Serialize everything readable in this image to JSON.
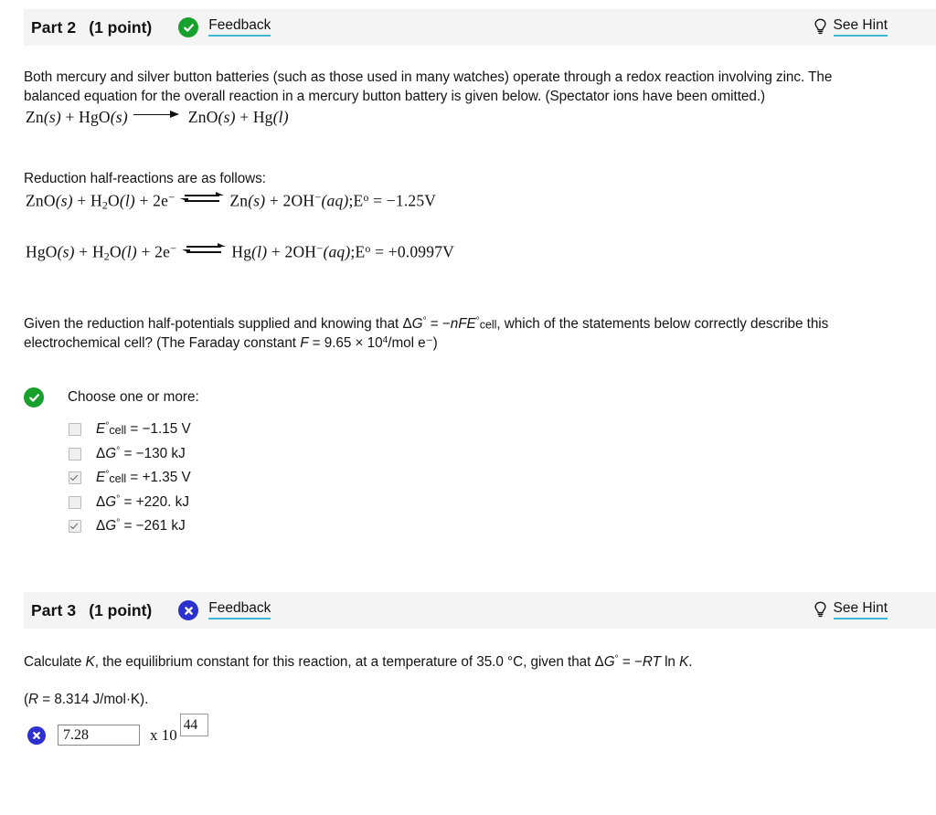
{
  "parts": [
    {
      "title": "Part 2",
      "points": "(1 point)",
      "status": "correct",
      "status_icon": "check-circle-icon",
      "status_color": "#17a02c",
      "feedback_label": "Feedback",
      "hint_label": "See Hint",
      "hint_icon": "lightbulb-icon"
    },
    {
      "title": "Part 3",
      "points": "(1 point)",
      "status": "incorrect",
      "status_icon": "x-circle-icon",
      "status_color": "#2b30cf",
      "feedback_label": "Feedback",
      "hint_label": "See Hint",
      "hint_icon": "lightbulb-icon"
    }
  ],
  "part2": {
    "intro_line1": "Both mercury and silver button batteries (such as those used in many watches) operate through a redox reaction involving zinc. The",
    "intro_line2": "balanced equation for the overall reaction in a mercury button battery is given below. (Spectator ions have been omitted.)",
    "overall_equation": {
      "left": "Zn(s) + HgO(s)",
      "right": "ZnO(s) + Hg(l)",
      "arrow": "long-right-arrow"
    },
    "halfrxn_heading": "Reduction half-reactions are as follows:",
    "half_reaction_1": {
      "reactants": "ZnO(s) + H2O(l) + 2e⁻",
      "products": "Zn(s) + 2OH⁻(aq)",
      "potential_label": "Eº",
      "potential_value": "−1.25V",
      "arrow": "equilibrium-arrow"
    },
    "half_reaction_2": {
      "reactants": "HgO(s) + H2O(l) + 2e⁻",
      "products": "Hg(l) + 2OH⁻(aq)",
      "potential_label": "Eº",
      "potential_value": "+0.0997V",
      "arrow": "equilibrium-arrow"
    },
    "prompt_part_a": "Given the reduction half-potentials supplied and knowing that",
    "prompt_formula": "ΔG° = −nFE°cell",
    "prompt_part_b": ", which of the statements below correctly describe this",
    "prompt_part_c": "electrochemical cell? (The Faraday constant",
    "prompt_faraday": "F = 9.65 × 10",
    "prompt_faraday_exp": "4",
    "prompt_faraday_units": "/mol e⁻)",
    "choose_label": "Choose one or more:",
    "choices": [
      {
        "label": "E°cell = −1.15 V",
        "symbol": "E",
        "sup": "°",
        "sub": "cell",
        "value": "= −1.15 V",
        "checked": false
      },
      {
        "label": "ΔG° = −130 kJ",
        "symbol": "ΔG",
        "sup": "°",
        "sub": "",
        "value": "= −130 kJ",
        "checked": false
      },
      {
        "label": "E°cell = +1.35 V",
        "symbol": "E",
        "sup": "°",
        "sub": "cell",
        "value": "= +1.35 V",
        "checked": true
      },
      {
        "label": "ΔG° = +220. kJ",
        "symbol": "ΔG",
        "sup": "°",
        "sub": "",
        "value": "= +220. kJ",
        "checked": false
      },
      {
        "label": "ΔG° = −261 kJ",
        "symbol": "ΔG",
        "sup": "°",
        "sub": "",
        "value": "= −261 kJ",
        "checked": true
      }
    ]
  },
  "part3": {
    "question_a": "Calculate",
    "question_k": "K",
    "question_b": ", the equilibrium constant for this reaction, at a temperature of 35.0 °C, given that",
    "question_formula": "ΔG° = −RT ln K.",
    "gas_constant": "(R = 8.314 J/mol·K).",
    "answer": {
      "mantissa_value": "7.28",
      "mantissa_placeholder": "",
      "multiplier_label": "x 10",
      "exponent_value": "44",
      "exponent_placeholder": "",
      "status_icon": "x-circle-icon"
    }
  }
}
